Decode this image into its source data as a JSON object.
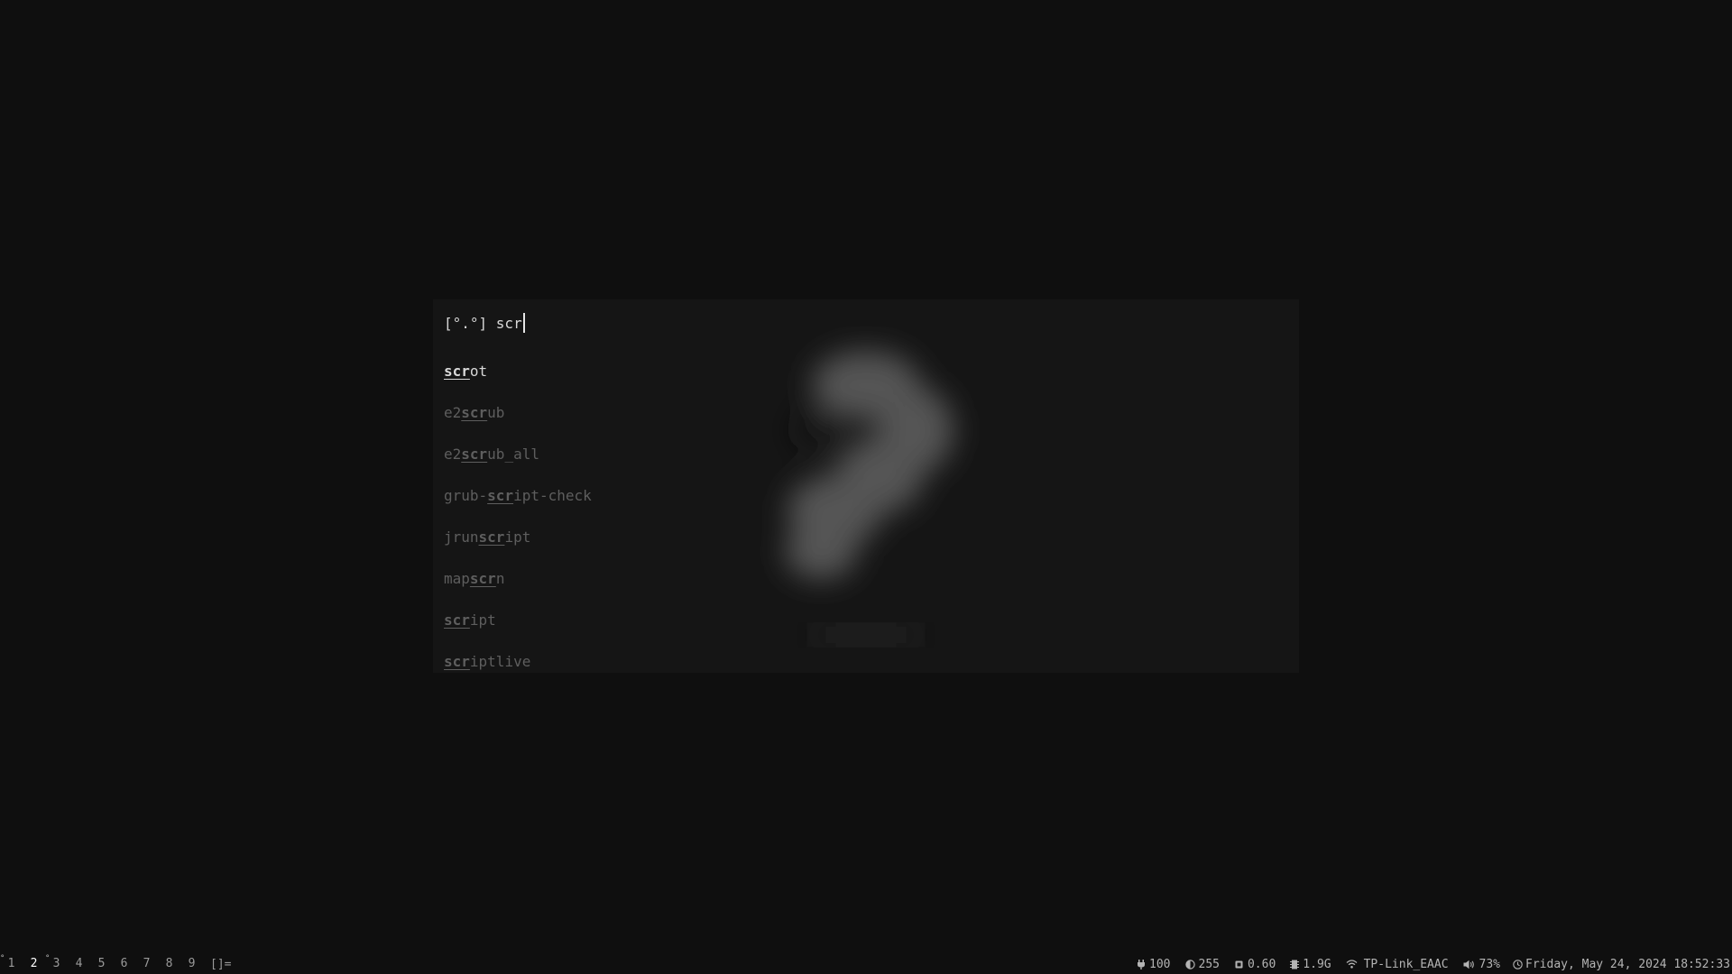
{
  "launcher": {
    "prompt": "[°.°] ",
    "query": "scr",
    "results": [
      {
        "pre": "",
        "match": "scr",
        "post": "ot",
        "selected": true
      },
      {
        "pre": "e2",
        "match": "scr",
        "post": "ub",
        "selected": false
      },
      {
        "pre": "e2",
        "match": "scr",
        "post": "ub_all",
        "selected": false
      },
      {
        "pre": "grub-",
        "match": "scr",
        "post": "ipt-check",
        "selected": false
      },
      {
        "pre": "jrun",
        "match": "scr",
        "post": "ipt",
        "selected": false
      },
      {
        "pre": "map",
        "match": "scr",
        "post": "n",
        "selected": false
      },
      {
        "pre": "",
        "match": "scr",
        "post": "ipt",
        "selected": false
      },
      {
        "pre": "",
        "match": "scr",
        "post": "iptlive",
        "selected": false
      }
    ]
  },
  "bar": {
    "workspaces": [
      {
        "label": "1",
        "dot": "°",
        "active": false
      },
      {
        "label": "2",
        "dot": "",
        "active": true
      },
      {
        "label": "3",
        "dot": "°",
        "active": false
      },
      {
        "label": "4",
        "dot": "",
        "active": false
      },
      {
        "label": "5",
        "dot": "",
        "active": false
      },
      {
        "label": "6",
        "dot": "",
        "active": false
      },
      {
        "label": "7",
        "dot": "",
        "active": false
      },
      {
        "label": "8",
        "dot": "",
        "active": false
      },
      {
        "label": "9",
        "dot": "",
        "active": false
      }
    ],
    "layout": "[]=",
    "battery": "100",
    "brightness": "255",
    "cpu": "0.60",
    "memory": "1.9G",
    "wifi": "TP-Link_EAAC",
    "volume": "73%",
    "clock": "Friday, May 24, 2024 18:52:33",
    "icons": {
      "battery": "plug-icon",
      "brightness": "brightness-icon",
      "cpu": "cpu-icon",
      "memory": "memory-icon",
      "wifi": "wifi-icon",
      "volume": "speaker-icon",
      "clock": "clock-icon"
    },
    "colors": {
      "background": "#0f0f0f",
      "text": "#b4b4b4",
      "active": "#ffffff"
    }
  }
}
